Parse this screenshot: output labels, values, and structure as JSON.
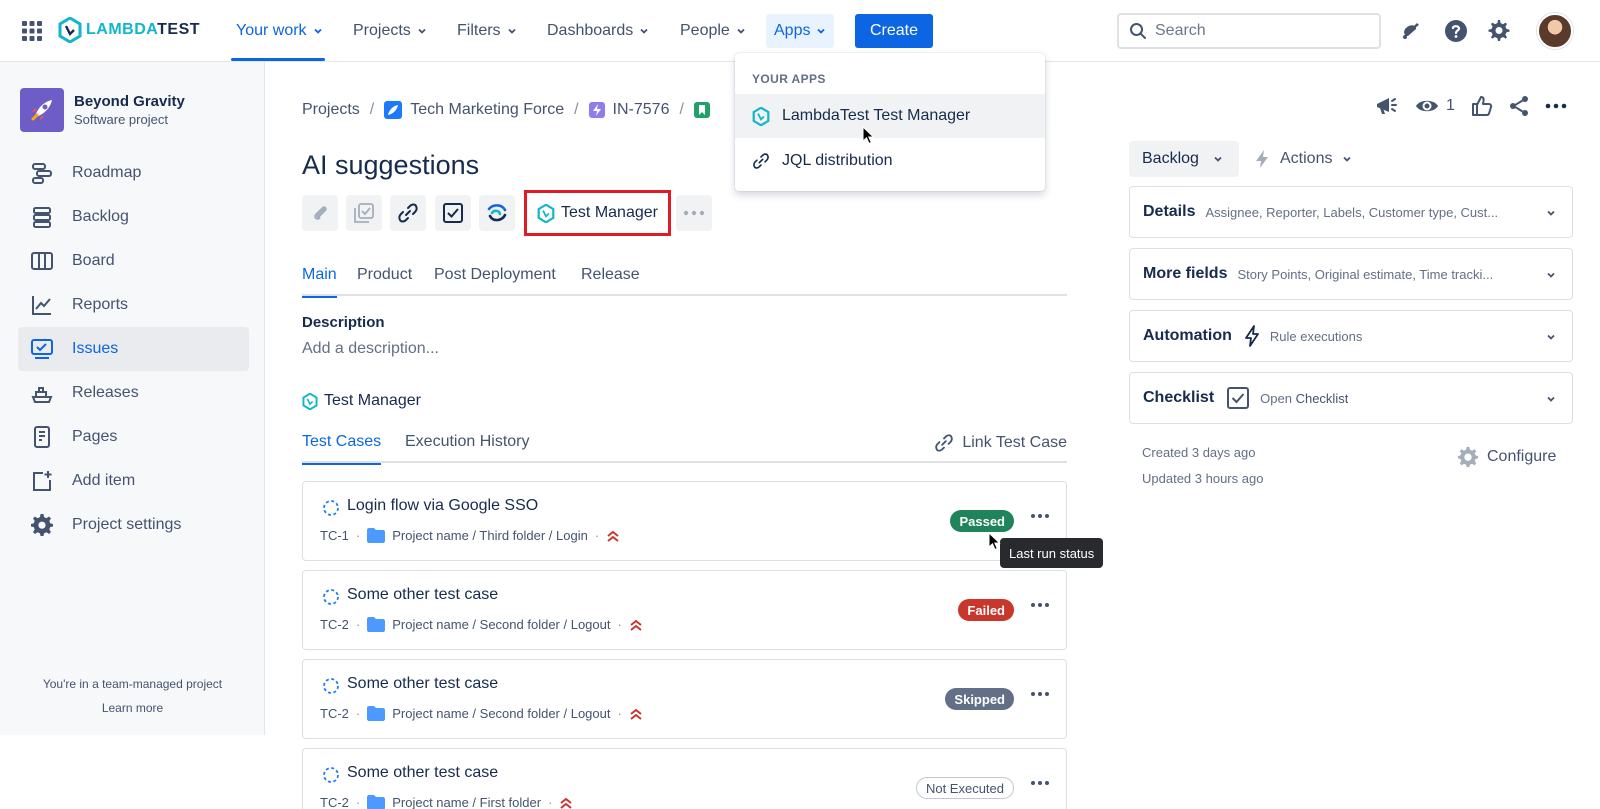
{
  "topnav": {
    "logo": {
      "part1": "LAMBDA",
      "part2": "TEST"
    },
    "items": [
      {
        "label": "Your work"
      },
      {
        "label": "Projects"
      },
      {
        "label": "Filters"
      },
      {
        "label": "Dashboards"
      },
      {
        "label": "People"
      },
      {
        "label": "Apps"
      }
    ],
    "create_label": "Create",
    "search_placeholder": "Search"
  },
  "apps_menu": {
    "heading": "YOUR APPS",
    "items": [
      {
        "label": "LambdaTest Test Manager",
        "icon": "lambdatest-icon"
      },
      {
        "label": "JQL distribution",
        "icon": "link-icon"
      }
    ]
  },
  "sidebar": {
    "project_name": "Beyond Gravity",
    "project_type": "Software project",
    "items": [
      {
        "label": "Roadmap",
        "icon": "roadmap-icon"
      },
      {
        "label": "Backlog",
        "icon": "backlog-icon"
      },
      {
        "label": "Board",
        "icon": "board-icon"
      },
      {
        "label": "Reports",
        "icon": "reports-icon"
      },
      {
        "label": "Issues",
        "icon": "issues-icon",
        "active": true
      },
      {
        "label": "Releases",
        "icon": "releases-icon"
      },
      {
        "label": "Pages",
        "icon": "pages-icon"
      },
      {
        "label": "Add item",
        "icon": "add-item-icon"
      },
      {
        "label": "Project settings",
        "icon": "gear-icon"
      }
    ],
    "footer_text": "You're in a team-managed project",
    "footer_link": "Learn more"
  },
  "breadcrumb": [
    "Projects",
    "Tech Marketing Force",
    "IN-7576"
  ],
  "issue": {
    "title": "AI suggestions",
    "toolbar": {
      "test_manager_label": "Test Manager"
    },
    "tabs": [
      "Main",
      "Product",
      "Post Deployment",
      "Release"
    ],
    "description_label": "Description",
    "description_placeholder": "Add a description..."
  },
  "test_manager": {
    "title": "Test Manager",
    "tabs": [
      "Test Cases",
      "Execution History"
    ],
    "link_label": "Link Test Case",
    "tooltip": "Last run status",
    "test_cases": [
      {
        "title": "Login flow via Google SSO",
        "id": "TC-1",
        "path": "Project name / Third folder / Login",
        "status": "Passed"
      },
      {
        "title": "Some other test case",
        "id": "TC-2",
        "path": "Project name / Second folder / Logout",
        "status": "Failed"
      },
      {
        "title": "Some other test case",
        "id": "TC-2",
        "path": "Project name / Second folder / Logout",
        "status": "Skipped"
      },
      {
        "title": "Some other test case",
        "id": "TC-2",
        "path": "Project name / First folder",
        "status": "Not Executed"
      }
    ]
  },
  "right_panel": {
    "watch_count": "1",
    "status_label": "Backlog",
    "actions_label": "Actions",
    "panels": [
      {
        "title": "Details",
        "summary": "Assignee, Reporter, Labels, Customer type, Cust..."
      },
      {
        "title": "More fields",
        "summary": "Story Points, Original estimate, Time tracki..."
      },
      {
        "title": "Automation",
        "summary": "Rule executions"
      },
      {
        "title": "Checklist",
        "summary_prefix": "Open",
        "summary": "Checklist"
      }
    ],
    "created": "Created 3 days ago",
    "updated": "Updated 3 hours ago",
    "configure_label": "Configure"
  },
  "colors": {
    "brand": "#0c66e4",
    "lambdatest": "#12b5cb",
    "passed": "#1f845a",
    "failed": "#c9372c",
    "skipped": "#626f86",
    "highlight": "#e01b24"
  }
}
